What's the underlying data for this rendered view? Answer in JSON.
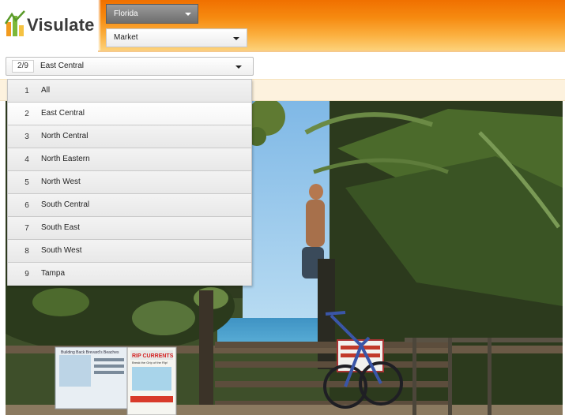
{
  "app": {
    "logo_text": "Visulate"
  },
  "header": {
    "state_select": {
      "value": "Florida"
    },
    "market_select": {
      "value": "Market"
    }
  },
  "region_select": {
    "count": "2/9",
    "value": "East Central"
  },
  "dropdown": {
    "items": [
      {
        "num": "1",
        "label": "All"
      },
      {
        "num": "2",
        "label": "East Central",
        "selected": true
      },
      {
        "num": "3",
        "label": "North Central"
      },
      {
        "num": "4",
        "label": "North Eastern"
      },
      {
        "num": "5",
        "label": "North West"
      },
      {
        "num": "6",
        "label": "South Central"
      },
      {
        "num": "7",
        "label": "South East"
      },
      {
        "num": "8",
        "label": "South West"
      },
      {
        "num": "9",
        "label": "Tampa"
      }
    ]
  },
  "photo": {
    "sign_left": {
      "text": "Building Back Brevard's Beaches"
    },
    "sign_rip": {
      "text": "RIP CURRENTS",
      "subtext": "Break the Grip of the Rip!"
    }
  },
  "colors": {
    "brand_orange": "#f68a10",
    "pale_band": "#fdf2de"
  }
}
